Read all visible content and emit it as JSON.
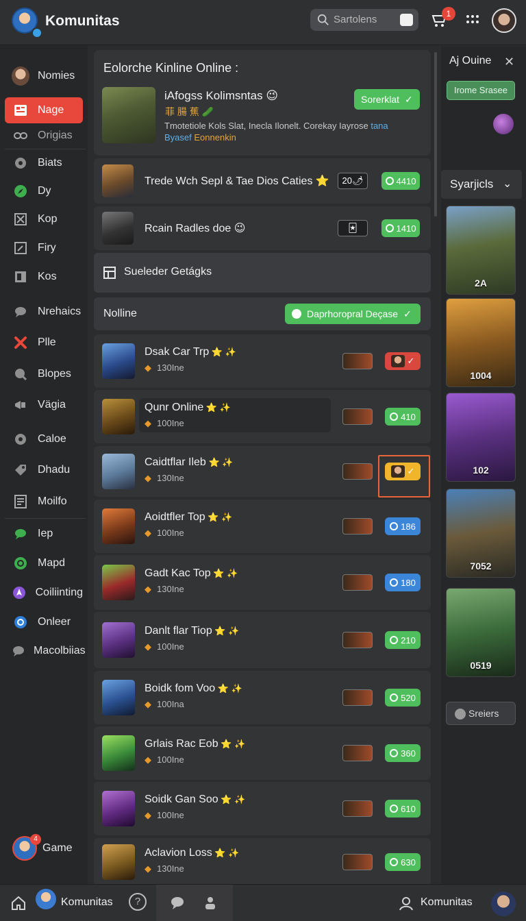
{
  "header": {
    "app_title": "Komunitas",
    "search_placeholder": "Sartolens",
    "cart_badge": "1"
  },
  "sidebar": {
    "items": [
      {
        "label": "Nomies",
        "icon": "profile-avatar-icon"
      },
      {
        "label": "Nage",
        "icon": "news-icon",
        "active": true
      },
      {
        "label": "Origias",
        "icon": "link-icon"
      },
      {
        "label": "Biats",
        "icon": "gamepad-icon"
      },
      {
        "label": "Dy",
        "icon": "compass-icon"
      },
      {
        "label": "Kop",
        "icon": "crossbox-icon"
      },
      {
        "label": "Firy",
        "icon": "edit-icon"
      },
      {
        "label": "Kos",
        "icon": "book-icon"
      },
      {
        "label": "Nrehaics",
        "icon": "chat-icon"
      },
      {
        "label": "Plle",
        "icon": "x-icon"
      },
      {
        "label": "Blopes",
        "icon": "search-icon"
      },
      {
        "label": "Vägia",
        "icon": "megaphone-icon"
      },
      {
        "label": "Caloe",
        "icon": "settings-icon"
      },
      {
        "label": "Dhadu",
        "icon": "tag-icon"
      },
      {
        "label": "Moilfo",
        "icon": "document-icon"
      },
      {
        "label": "Iep",
        "icon": "chat-green-icon"
      },
      {
        "label": "Mapd",
        "icon": "map-icon"
      },
      {
        "label": "Coiliinting",
        "icon": "nav-arrow-icon"
      },
      {
        "label": "Onleer",
        "icon": "globe-icon"
      },
      {
        "label": "Macolbiias",
        "icon": "comment-icon"
      }
    ],
    "game_label": "Game",
    "game_badge": "4"
  },
  "main": {
    "featured": {
      "panel_title": "Eolorche Kinline Online :",
      "title": "iAfogss Kolimsntas 😉",
      "tags": "菲 腸 蕉 🥒",
      "desc_main": "Tmotetiole Kols Slat, Inecla Ilonelt. Corekay Iayrose",
      "desc_accent": "tana",
      "desc_blue": "Byasef",
      "desc_orange": "Eonnenkin",
      "button": "Sorerklat"
    },
    "top_rows": [
      {
        "title": "Trede Wch Sepl & Tae Dios Caties ⭐",
        "mini": "20🌶",
        "pill": "4410",
        "color": "green"
      },
      {
        "title": "Rcain Radles doe 😉",
        "mini": "🃏",
        "pill": "1410",
        "color": "green"
      }
    ],
    "section_label": "Sueleder Getágks",
    "online_label": "Nolline",
    "online_button": "Daprhoropral Deçase",
    "game_rows": [
      {
        "title": "Dsak Car Trp",
        "sub": "130Ine",
        "pill": "✓",
        "color": "red"
      },
      {
        "title": "Qunr Online",
        "sub": "100Ine",
        "pill": "410",
        "color": "green"
      },
      {
        "title": "Caidtflar Ileb",
        "sub": "130Ine",
        "pill": "✓",
        "color": "yellow"
      },
      {
        "title": "Aoidtfler Top",
        "sub": "100Ine",
        "pill": "186",
        "color": "blue"
      },
      {
        "title": "Gadt Kac Top",
        "sub": "130Ine",
        "pill": "180",
        "color": "blue"
      },
      {
        "title": "Danlt flar Tiop",
        "sub": "100Ine",
        "pill": "210",
        "color": "green"
      },
      {
        "title": "Boidk fom Voo",
        "sub": "100Ina",
        "pill": "520",
        "color": "green"
      },
      {
        "title": "Grlais Rac Eob",
        "sub": "100Ine",
        "pill": "360",
        "color": "green"
      },
      {
        "title": "Soidk Gan Soo",
        "sub": "100Ine",
        "pill": "610",
        "color": "green"
      },
      {
        "title": "Aclavion Loss",
        "sub": "130Ine",
        "pill": "630",
        "color": "green"
      }
    ]
  },
  "right_panel": {
    "heading": "Aj Ouine",
    "button": "Irome Srasee",
    "section": "Syarjicls",
    "cards": [
      "2A",
      "1004",
      "102",
      "7052",
      "0519"
    ],
    "footer": "Sreiers"
  },
  "bottom_bar": {
    "left_label": "Komunitas",
    "right_label": "Komunitas"
  }
}
